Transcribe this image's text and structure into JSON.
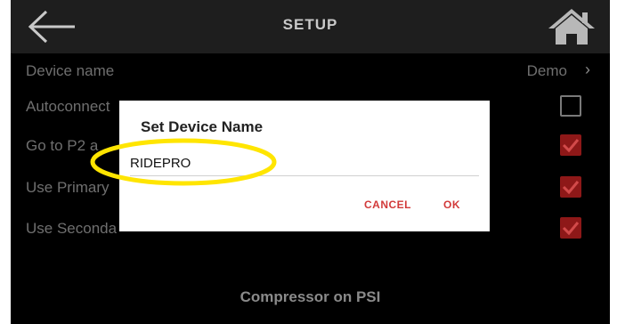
{
  "header": {
    "title": "SETUP",
    "back_icon": "back-arrow-icon",
    "home_icon": "home-icon"
  },
  "settings": [
    {
      "label": "Device name",
      "value": "Demo",
      "chevron": "›"
    },
    {
      "label": "Autoconnect",
      "checked": false
    },
    {
      "label": "Go to P2 a",
      "checked": true
    },
    {
      "label": "Use Primary",
      "checked": true
    },
    {
      "label": "Use Seconda",
      "checked": true
    }
  ],
  "footer": {
    "label": "Compressor on PSI"
  },
  "dialog": {
    "title": "Set Device Name",
    "input_value": "RIDEPRO",
    "cancel_label": "CANCEL",
    "ok_label": "OK"
  },
  "colors": {
    "accent": "#d23a3a",
    "checkbox_checked": "#8e1818",
    "highlight": "#ffe500"
  }
}
